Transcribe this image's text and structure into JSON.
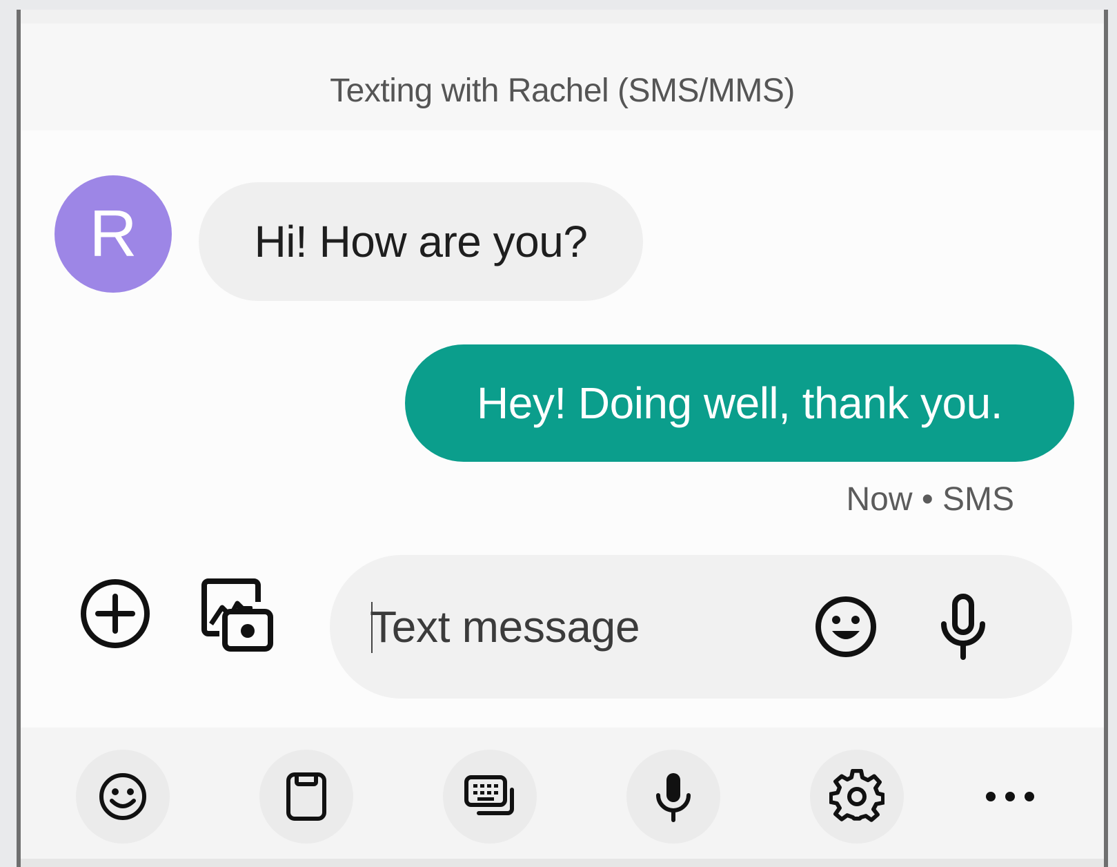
{
  "header": {
    "title": "Texting with Rachel (SMS/MMS)"
  },
  "conversation": {
    "contact_initial": "R",
    "avatar_color": "#9d86e6",
    "incoming": {
      "text": "Hi! How are you?"
    },
    "outgoing": {
      "text": "Hey! Doing well, thank you.",
      "color": "#0b9e8c",
      "meta": "Now • SMS"
    }
  },
  "composer": {
    "placeholder": "Text message",
    "attach_icon": "add-circle-icon",
    "gallery_icon": "gallery-camera-icon",
    "emoji_icon": "emoji-icon",
    "voice_icon": "microphone-icon"
  },
  "keyboard_toolbar": {
    "items": [
      {
        "icon": "emoji-icon"
      },
      {
        "icon": "clipboard-icon"
      },
      {
        "icon": "keyboard-mode-icon"
      },
      {
        "icon": "voice-input-icon"
      },
      {
        "icon": "settings-gear-icon"
      },
      {
        "icon": "more-horizontal-icon"
      }
    ]
  }
}
